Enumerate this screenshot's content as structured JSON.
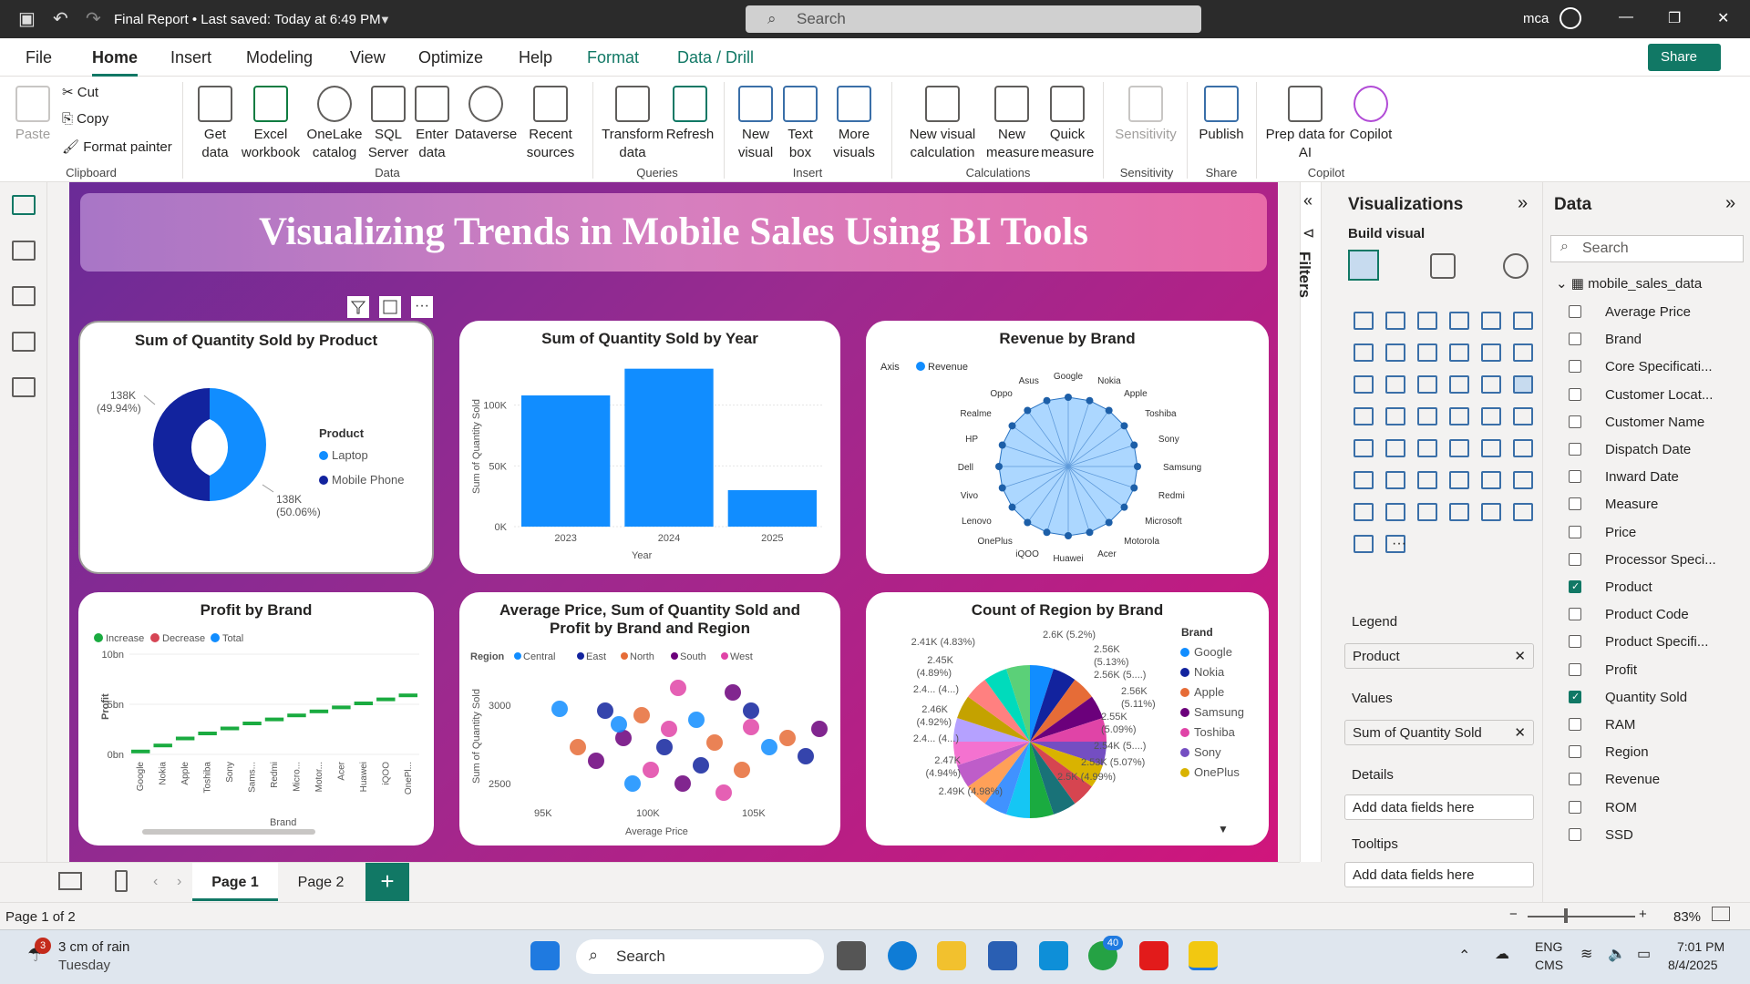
{
  "titlebar": {
    "title": "Final Report • Last saved: Today at 6:49 PM",
    "search_placeholder": "Search",
    "user": "mca"
  },
  "menu": {
    "items": [
      "File",
      "Home",
      "Insert",
      "Modeling",
      "View",
      "Optimize",
      "Help",
      "Format",
      "Data / Drill"
    ],
    "share": "Share"
  },
  "ribbon": {
    "clipboard": {
      "paste": "Paste",
      "cut": "Cut",
      "copy": "Copy",
      "format_painter": "Format painter",
      "group": "Clipboard"
    },
    "data": {
      "get_data": "Get data",
      "excel": "Excel workbook",
      "onelake": "OneLake catalog",
      "sql": "SQL Server",
      "enter": "Enter data",
      "dataverse": "Dataverse",
      "recent": "Recent sources",
      "group": "Data"
    },
    "queries": {
      "transform": "Transform data",
      "refresh": "Refresh",
      "group": "Queries"
    },
    "insert": {
      "new_visual": "New visual",
      "text_box": "Text box",
      "more_visuals": "More visuals",
      "group": "Insert"
    },
    "calc": {
      "new_visual_calc": "New visual calculation",
      "new_measure": "New measure",
      "quick_measure": "Quick measure",
      "group": "Calculations"
    },
    "sensitivity": {
      "label": "Sensitivity",
      "group": "Sensitivity"
    },
    "share": {
      "publish": "Publish",
      "group": "Share"
    },
    "copilot": {
      "prep": "Prep data for AI",
      "copilot": "Copilot",
      "group": "Copilot"
    }
  },
  "report": {
    "banner": "Visualizing Trends in Mobile Sales Using BI Tools",
    "donut": {
      "title": "Sum of Quantity Sold by Product",
      "legend_title": "Product",
      "label1": "138K",
      "label1b": "(49.94%)",
      "label2": "138K",
      "label2b": "(50.06%)"
    },
    "bar_year": {
      "title": "Sum of Quantity Sold by Year",
      "ylabel": "Sum of Quantity Sold",
      "xlabel": "Year"
    },
    "radar": {
      "title": "Revenue by Brand",
      "axis_label": "Axis",
      "series": "Revenue",
      "brands": [
        "Google",
        "Nokia",
        "Apple",
        "Toshiba",
        "Sony",
        "Samsung",
        "Redmi",
        "Microsoft",
        "Motorola",
        "Acer",
        "Huawei",
        "iQOO",
        "OnePlus",
        "Lenovo",
        "Vivo",
        "Dell",
        "HP",
        "Realme",
        "Oppo",
        "Asus"
      ]
    },
    "profit": {
      "title": "Profit by Brand",
      "legend": [
        "Increase",
        "Decrease",
        "Total"
      ],
      "ylabel": "Profit",
      "xlabel": "Brand",
      "ticks": [
        "10bn",
        "5bn",
        "0bn"
      ],
      "brands": [
        "Google",
        "Nokia",
        "Apple",
        "Toshiba",
        "Sony",
        "Sams...",
        "Redmi",
        "Micro...",
        "Motor...",
        "Acer",
        "Huawei",
        "iQOO",
        "OnePl..."
      ]
    },
    "scatter": {
      "title": "Average Price, Sum of Quantity Sold and Profit by Brand and Region",
      "legend_title": "Region",
      "regions": [
        "Central",
        "East",
        "North",
        "South",
        "West"
      ],
      "ylabel": "Sum of Quantity Sold",
      "xlabel": "Average Price",
      "yticks": [
        "3000",
        "2500"
      ],
      "xticks": [
        "95K",
        "100K",
        "105K"
      ]
    },
    "pie": {
      "title": "Count of Region by Brand",
      "legend_title": "Brand",
      "legend": [
        "Google",
        "Nokia",
        "Apple",
        "Samsung",
        "Toshiba",
        "Sony",
        "OnePlus"
      ],
      "labels_right": [
        "2.6K (5.2%)",
        "2.56K",
        "(5.13%)",
        "2.56K (5....)",
        "2.56K",
        "(5.11%)",
        "2.55K",
        "(5.09%)",
        "2.54K (5....)",
        "2.53K (5.07%)",
        "2.5K (4.99%)"
      ],
      "labels_left": [
        "2.41K (4.83%)",
        "2.45K",
        "(4.89%)",
        "2.4... (4...)",
        "2.46K",
        "(4.92%)",
        "2.4... (4...)",
        "2.47K",
        "(4.94%)",
        "2.49K (4.98%)"
      ]
    }
  },
  "chart_data": [
    {
      "type": "pie",
      "title": "Sum of Quantity Sold by Product",
      "categories": [
        "Laptop",
        "Mobile Phone"
      ],
      "values": [
        138000,
        138000
      ],
      "percent": [
        49.94,
        50.06
      ]
    },
    {
      "type": "bar",
      "title": "Sum of Quantity Sold by Year",
      "categories": [
        "2023",
        "2024",
        "2025"
      ],
      "values": [
        108000,
        130000,
        30000
      ],
      "xlabel": "Year",
      "ylabel": "Sum of Quantity Sold",
      "yticks": [
        "0K",
        "50K",
        "100K"
      ],
      "ylim": [
        0,
        135000
      ]
    },
    {
      "type": "line",
      "title": "Profit by Brand",
      "categories": [
        "Google",
        "Nokia",
        "Apple",
        "Toshiba",
        "Sony",
        "Sams...",
        "Redmi",
        "Micro...",
        "Motor...",
        "Acer",
        "Huawei",
        "iQOO",
        "OnePl..."
      ],
      "values": [
        0.2,
        0.8,
        1.5,
        2.0,
        2.5,
        3.0,
        3.4,
        3.8,
        4.2,
        4.6,
        5.0,
        5.4,
        5.8
      ],
      "ylim": [
        0,
        10
      ],
      "unit": "bn"
    }
  ],
  "filters_label": "Filters",
  "visualizations": {
    "title": "Visualizations",
    "build": "Build visual",
    "legend_label": "Legend",
    "legend_value": "Product",
    "values_label": "Values",
    "values_value": "Sum of Quantity Sold",
    "details_label": "Details",
    "tooltips_label": "Tooltips",
    "placeholder": "Add data fields here"
  },
  "data_pane": {
    "title": "Data",
    "search": "Search",
    "table": "mobile_sales_data",
    "fields": [
      {
        "name": "Average Price",
        "checked": false
      },
      {
        "name": "Brand",
        "checked": false
      },
      {
        "name": "Core Specificati...",
        "checked": false
      },
      {
        "name": "Customer Locat...",
        "checked": false
      },
      {
        "name": "Customer Name",
        "checked": false
      },
      {
        "name": "Dispatch Date",
        "checked": false
      },
      {
        "name": "Inward Date",
        "checked": false
      },
      {
        "name": "Measure",
        "checked": false
      },
      {
        "name": "Price",
        "checked": false
      },
      {
        "name": "Processor Speci...",
        "checked": false
      },
      {
        "name": "Product",
        "checked": true
      },
      {
        "name": "Product Code",
        "checked": false
      },
      {
        "name": "Product Specifi...",
        "checked": false
      },
      {
        "name": "Profit",
        "checked": false
      },
      {
        "name": "Quantity Sold",
        "checked": true
      },
      {
        "name": "RAM",
        "checked": false
      },
      {
        "name": "Region",
        "checked": false
      },
      {
        "name": "Revenue",
        "checked": false
      },
      {
        "name": "ROM",
        "checked": false
      },
      {
        "name": "SSD",
        "checked": false
      }
    ]
  },
  "pages": {
    "page1": "Page 1",
    "page2": "Page 2",
    "status": "Page 1 of 2",
    "zoom": "83%"
  },
  "taskbar": {
    "weather": "3 cm of rain",
    "day": "Tuesday",
    "badge": "3",
    "search": "Search",
    "lang1": "ENG",
    "lang2": "CMS",
    "time": "7:01 PM",
    "date": "8/4/2025",
    "chat_badge": "40"
  }
}
